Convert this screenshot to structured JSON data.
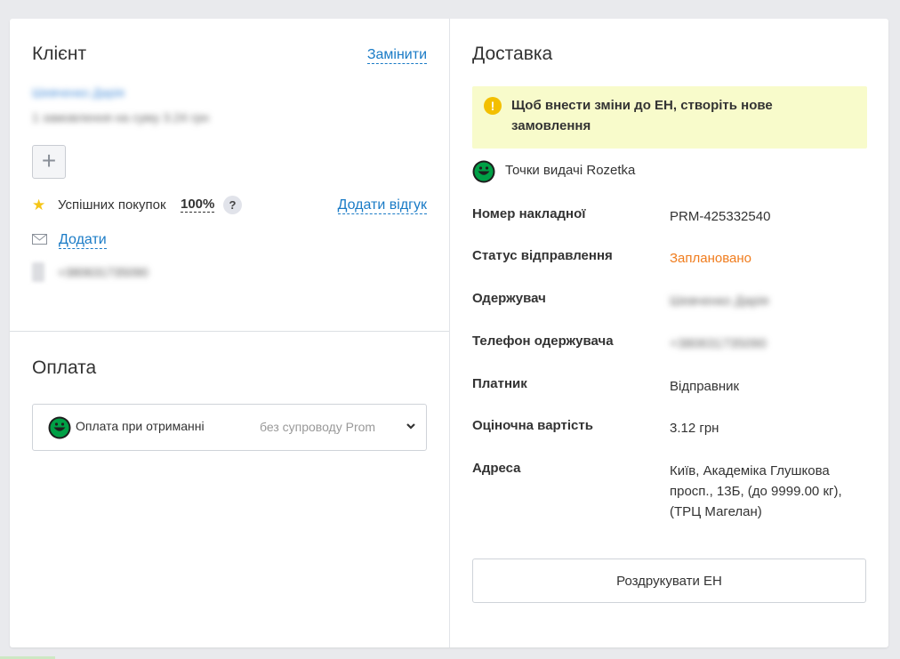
{
  "client": {
    "title": "Клієнт",
    "replace_label": "Замінити",
    "name": "Шевченко Дарія",
    "orders_summary": "1 замовлення на суму 3.24 грн",
    "add_symbol": "+",
    "success_label": "Успішних покупок",
    "success_value": "100%",
    "help_symbol": "?",
    "add_review_label": "Додати відгук",
    "email_add_label": "Додати",
    "phone": "+380631735090"
  },
  "payment": {
    "title": "Оплата",
    "method": "Оплата при отриманні",
    "note": "без супроводу Prom"
  },
  "delivery": {
    "title": "Доставка",
    "notice_icon": "!",
    "notice": "Щоб внести зміни до ЕН, створіть нове замовлення",
    "carrier": "Точки видачі Rozetka",
    "rows": [
      {
        "label": "Номер накладної",
        "value": "PRM-425332540"
      },
      {
        "label": "Статус відправлення",
        "value": "Заплановано"
      },
      {
        "label": "Одержувач",
        "value": "Шевченко Дарія"
      },
      {
        "label": "Телефон одержувача",
        "value": "+380631735090"
      },
      {
        "label": "Платник",
        "value": "Відправник"
      },
      {
        "label": "Оціночна вартість",
        "value": "3.12 грн"
      },
      {
        "label": "Адреса",
        "value": "Київ, Академіка Глушкова просп., 13Б, (до 9999.00 кг), (ТРЦ Магелан)"
      }
    ],
    "print_label": "Роздрукувати ЕН"
  },
  "colors": {
    "link": "#1a7bc6",
    "status": "#f07c1d",
    "notice_bg": "#f8fbcb",
    "brand_green": "#00a046"
  },
  "icons": [
    "star-icon",
    "help-icon",
    "mail-icon",
    "phone-icon",
    "rozetka-logo-icon",
    "chevron-down-icon",
    "warning-icon",
    "plus-icon"
  ]
}
